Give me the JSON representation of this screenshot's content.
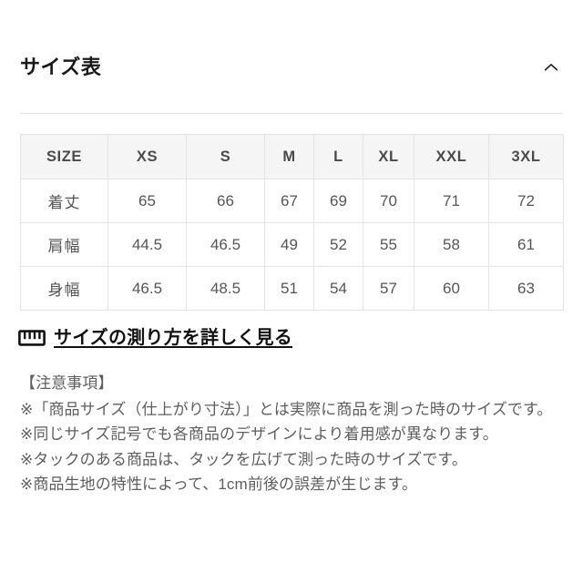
{
  "section": {
    "title": "サイズ表",
    "toggle_icon": "chevron-up-icon"
  },
  "table": {
    "columns": [
      "SIZE",
      "XS",
      "S",
      "M",
      "L",
      "XL",
      "XXL",
      "3XL"
    ],
    "rows": [
      {
        "label": "着丈",
        "values": [
          "65",
          "66",
          "67",
          "69",
          "70",
          "71",
          "72"
        ]
      },
      {
        "label": "肩幅",
        "values": [
          "44.5",
          "46.5",
          "49",
          "52",
          "55",
          "58",
          "61"
        ]
      },
      {
        "label": "身幅",
        "values": [
          "46.5",
          "48.5",
          "51",
          "54",
          "57",
          "60",
          "63"
        ]
      }
    ]
  },
  "measure_link": {
    "icon": "ruler-icon",
    "label": "サイズの測り方を詳しく見る"
  },
  "notes": {
    "heading": "【注意事項】",
    "lines": [
      "※「商品サイズ（仕上がり寸法）」とは実際に商品を測った時のサイズです。",
      "※同じサイズ記号でも各商品のデザインにより着用感が異なります。",
      "※タックのある商品は、タックを広げて測った時のサイズです。",
      "※商品生地の特性によって、1cm前後の誤差が生じます。"
    ]
  },
  "colors": {
    "background": "#ffffff",
    "text_primary": "#1a1a1a",
    "text_secondary": "#5e5e5e",
    "border": "#e4e4e4",
    "header_fill": "#f5f5f5"
  }
}
